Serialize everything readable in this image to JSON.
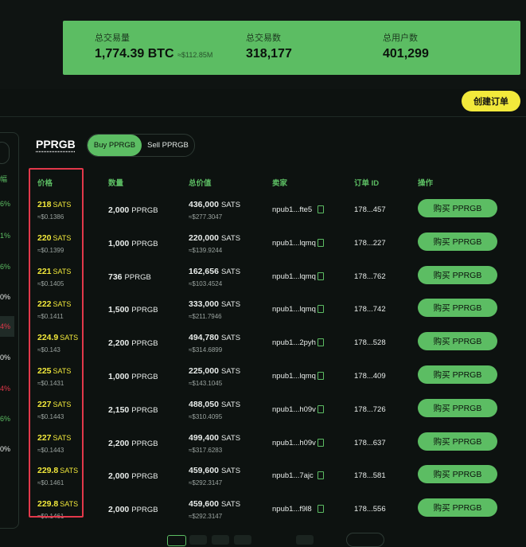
{
  "stats": {
    "volume_label": "总交易量",
    "volume_value": "1,774.39 BTC",
    "volume_usd": "≈$112.85M",
    "trades_label": "总交易数",
    "trades_value": "318,177",
    "users_label": "总用户数",
    "users_value": "401,299"
  },
  "create_order_label": "创建订单",
  "left_panel": {
    "header": "幅",
    "percents": [
      {
        "text": "6%",
        "color": "#5cbd63"
      },
      {
        "text": "1%",
        "color": "#5cbd63"
      },
      {
        "text": "6%",
        "color": "#5cbd63"
      },
      {
        "text": "0%",
        "color": "#e8ecea"
      },
      {
        "text": "4%",
        "color": "#e2384a"
      },
      {
        "text": "0%",
        "color": "#e8ecea"
      },
      {
        "text": "4%",
        "color": "#e2384a"
      },
      {
        "text": "6%",
        "color": "#5cbd63"
      },
      {
        "text": "0%",
        "color": "#e8ecea"
      }
    ]
  },
  "token": "PPRGB",
  "toggle": {
    "buy": "Buy PPRGB",
    "sell": "Sell PPRGB"
  },
  "columns": {
    "price": "价格",
    "quantity": "数量",
    "total": "总价值",
    "seller": "卖家",
    "order_id": "订单 ID",
    "action": "操作"
  },
  "rows": [
    {
      "price": "218",
      "price_unit": "SATS",
      "price_usd": "≈$0.1386",
      "qty": "2,000",
      "qty_unit": "PPRGB",
      "total": "436,000",
      "total_unit": "SATS",
      "total_usd": "≈$277.3047",
      "seller": "npub1...fte5",
      "order": "178...457",
      "btn": "购买 PPRGB"
    },
    {
      "price": "220",
      "price_unit": "SATS",
      "price_usd": "≈$0.1399",
      "qty": "1,000",
      "qty_unit": "PPRGB",
      "total": "220,000",
      "total_unit": "SATS",
      "total_usd": "≈$139.9244",
      "seller": "npub1...lqmq",
      "order": "178...227",
      "btn": "购买 PPRGB"
    },
    {
      "price": "221",
      "price_unit": "SATS",
      "price_usd": "≈$0.1405",
      "qty": "736",
      "qty_unit": "PPRGB",
      "total": "162,656",
      "total_unit": "SATS",
      "total_usd": "≈$103.4524",
      "seller": "npub1...lqmq",
      "order": "178...762",
      "btn": "购买 PPRGB"
    },
    {
      "price": "222",
      "price_unit": "SATS",
      "price_usd": "≈$0.1411",
      "qty": "1,500",
      "qty_unit": "PPRGB",
      "total": "333,000",
      "total_unit": "SATS",
      "total_usd": "≈$211.7946",
      "seller": "npub1...lqmq",
      "order": "178...742",
      "btn": "购买 PPRGB"
    },
    {
      "price": "224.9",
      "price_unit": "SATS",
      "price_usd": "≈$0.143",
      "qty": "2,200",
      "qty_unit": "PPRGB",
      "total": "494,780",
      "total_unit": "SATS",
      "total_usd": "≈$314.6899",
      "seller": "npub1...2pyh",
      "order": "178...528",
      "btn": "购买 PPRGB"
    },
    {
      "price": "225",
      "price_unit": "SATS",
      "price_usd": "≈$0.1431",
      "qty": "1,000",
      "qty_unit": "PPRGB",
      "total": "225,000",
      "total_unit": "SATS",
      "total_usd": "≈$143.1045",
      "seller": "npub1...lqmq",
      "order": "178...409",
      "btn": "购买 PPRGB"
    },
    {
      "price": "227",
      "price_unit": "SATS",
      "price_usd": "≈$0.1443",
      "qty": "2,150",
      "qty_unit": "PPRGB",
      "total": "488,050",
      "total_unit": "SATS",
      "total_usd": "≈$310.4095",
      "seller": "npub1...h09v",
      "order": "178...726",
      "btn": "购买 PPRGB"
    },
    {
      "price": "227",
      "price_unit": "SATS",
      "price_usd": "≈$0.1443",
      "qty": "2,200",
      "qty_unit": "PPRGB",
      "total": "499,400",
      "total_unit": "SATS",
      "total_usd": "≈$317.6283",
      "seller": "npub1...h09v",
      "order": "178...637",
      "btn": "购买 PPRGB"
    },
    {
      "price": "229.8",
      "price_unit": "SATS",
      "price_usd": "≈$0.1461",
      "qty": "2,000",
      "qty_unit": "PPRGB",
      "total": "459,600",
      "total_unit": "SATS",
      "total_usd": "≈$292.3147",
      "seller": "npub1...7ajc",
      "order": "178...581",
      "btn": "购买 PPRGB"
    },
    {
      "price": "229.8",
      "price_unit": "SATS",
      "price_usd": "≈$0.1461",
      "qty": "2,000",
      "qty_unit": "PPRGB",
      "total": "459,600",
      "total_unit": "SATS",
      "total_usd": "≈$292.3147",
      "seller": "npub1...f9l8",
      "order": "178...556",
      "btn": "购买 PPRGB"
    }
  ],
  "colors": {
    "accent_green": "#5cbd63",
    "accent_yellow": "#f2e93b",
    "highlight_red": "#e2384a",
    "background": "#0d1210"
  }
}
